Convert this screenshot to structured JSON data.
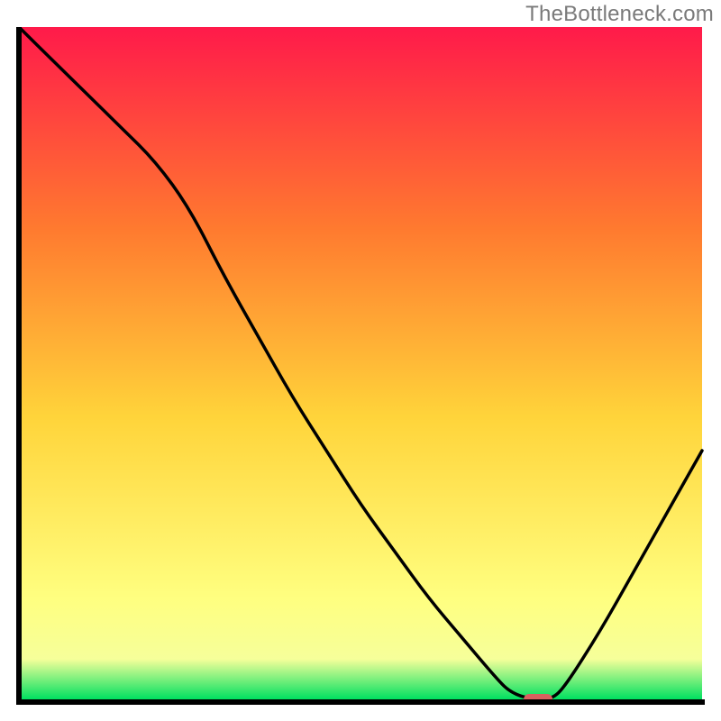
{
  "watermark": "TheBottleneck.com",
  "colors": {
    "gradient_top": "#ff1a4a",
    "gradient_mid_upper": "#ff7a2f",
    "gradient_mid": "#ffd43a",
    "gradient_lower": "#ffff80",
    "gradient_bottom": "#00e060",
    "curve": "#000000",
    "marker": "#d9605f",
    "axis": "#000000"
  },
  "chart_data": {
    "type": "line",
    "title": "",
    "xlabel": "",
    "ylabel": "",
    "xlim": [
      0,
      100
    ],
    "ylim": [
      0,
      100
    ],
    "x": [
      0,
      5,
      10,
      15,
      20,
      25,
      30,
      35,
      40,
      45,
      50,
      55,
      60,
      65,
      70,
      72,
      75,
      78,
      80,
      85,
      90,
      95,
      100
    ],
    "values": [
      100,
      95,
      90,
      85,
      80,
      73,
      63,
      54,
      45,
      37,
      29,
      22,
      15,
      9,
      3,
      1,
      0,
      0,
      2,
      10,
      19,
      28,
      37
    ],
    "optimal_x": 76,
    "optimal_y": 0,
    "annotations": []
  }
}
